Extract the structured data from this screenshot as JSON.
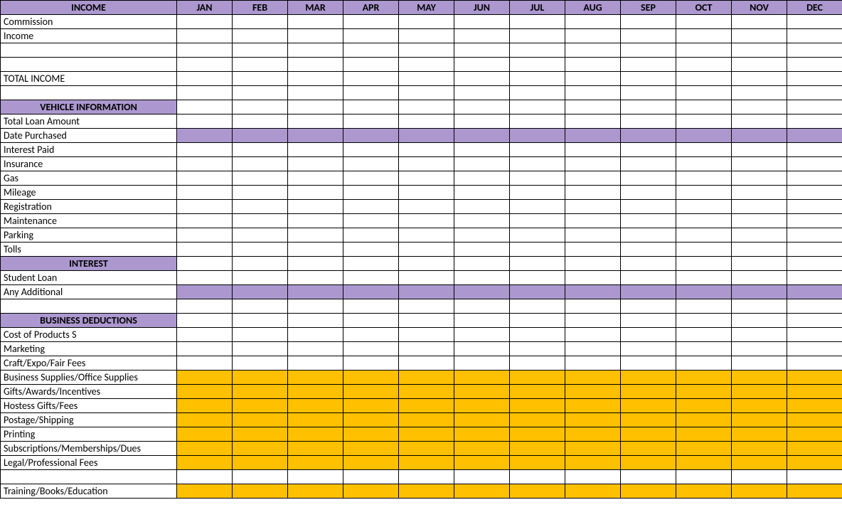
{
  "header": {
    "label": "INCOME",
    "months": [
      "JAN",
      "FEB",
      "MAR",
      "APR",
      "MAY",
      "JUN",
      "JUL",
      "AUG",
      "SEP",
      "OCT",
      "NOV",
      "DEC"
    ]
  },
  "rows": [
    {
      "label": "Commission",
      "type": "data"
    },
    {
      "label": "Income",
      "type": "data"
    },
    {
      "label": "",
      "type": "data"
    },
    {
      "label": "",
      "type": "data"
    },
    {
      "label": "TOTAL INCOME",
      "type": "data"
    },
    {
      "label": "",
      "type": "data"
    },
    {
      "label": "VEHICLE INFORMATION",
      "type": "section"
    },
    {
      "label": "Total Loan Amount",
      "type": "data"
    },
    {
      "label": "Date Purchased",
      "type": "data",
      "fill": "purple"
    },
    {
      "label": "Interest Paid",
      "type": "data"
    },
    {
      "label": "Insurance",
      "type": "data"
    },
    {
      "label": "Gas",
      "type": "data"
    },
    {
      "label": "Mileage",
      "type": "data"
    },
    {
      "label": "Registration",
      "type": "data"
    },
    {
      "label": "Maintenance",
      "type": "data"
    },
    {
      "label": "Parking",
      "type": "data"
    },
    {
      "label": "Tolls",
      "type": "data"
    },
    {
      "label": "INTEREST",
      "type": "section"
    },
    {
      "label": "Student Loan",
      "type": "data"
    },
    {
      "label": "Any Additional",
      "type": "data",
      "fill": "purple"
    },
    {
      "label": "",
      "type": "data"
    },
    {
      "label": "BUSINESS DEDUCTIONS",
      "type": "section"
    },
    {
      "label": "Cost of Products S",
      "type": "data"
    },
    {
      "label": "Marketing",
      "type": "data"
    },
    {
      "label": "Craft/Expo/Fair Fees",
      "type": "data"
    },
    {
      "label": "Business Supplies/Office Supplies",
      "type": "data",
      "fill": "orange"
    },
    {
      "label": "Gifts/Awards/Incentives",
      "type": "data",
      "fill": "orange"
    },
    {
      "label": "Hostess Gifts/Fees",
      "type": "data",
      "fill": "orange"
    },
    {
      "label": "Postage/Shipping",
      "type": "data",
      "fill": "orange"
    },
    {
      "label": "Printing",
      "type": "data",
      "fill": "orange"
    },
    {
      "label": "Subscriptions/Memberships/Dues",
      "type": "data",
      "fill": "orange"
    },
    {
      "label": "Legal/Professional Fees",
      "type": "data",
      "fill": "orange"
    },
    {
      "label": "",
      "type": "data"
    },
    {
      "label": "Training/Books/Education",
      "type": "data",
      "fill": "orange"
    }
  ]
}
